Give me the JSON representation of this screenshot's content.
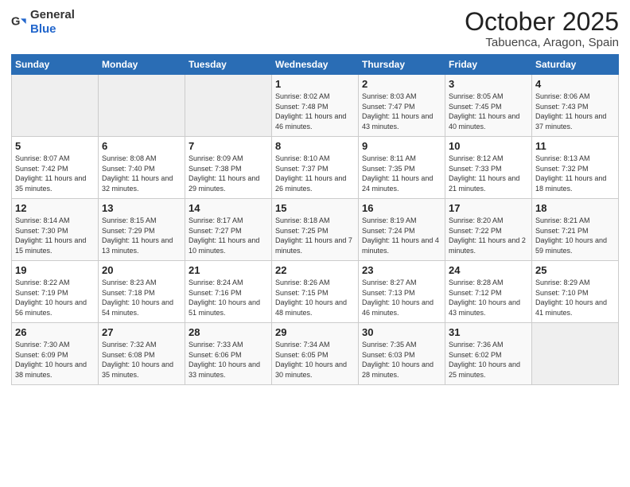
{
  "header": {
    "logo_general": "General",
    "logo_blue": "Blue",
    "title": "October 2025",
    "subtitle": "Tabuenca, Aragon, Spain"
  },
  "columns": [
    "Sunday",
    "Monday",
    "Tuesday",
    "Wednesday",
    "Thursday",
    "Friday",
    "Saturday"
  ],
  "weeks": [
    [
      {
        "day": "",
        "sunrise": "",
        "sunset": "",
        "daylight": ""
      },
      {
        "day": "",
        "sunrise": "",
        "sunset": "",
        "daylight": ""
      },
      {
        "day": "",
        "sunrise": "",
        "sunset": "",
        "daylight": ""
      },
      {
        "day": "1",
        "sunrise": "Sunrise: 8:02 AM",
        "sunset": "Sunset: 7:48 PM",
        "daylight": "Daylight: 11 hours and 46 minutes."
      },
      {
        "day": "2",
        "sunrise": "Sunrise: 8:03 AM",
        "sunset": "Sunset: 7:47 PM",
        "daylight": "Daylight: 11 hours and 43 minutes."
      },
      {
        "day": "3",
        "sunrise": "Sunrise: 8:05 AM",
        "sunset": "Sunset: 7:45 PM",
        "daylight": "Daylight: 11 hours and 40 minutes."
      },
      {
        "day": "4",
        "sunrise": "Sunrise: 8:06 AM",
        "sunset": "Sunset: 7:43 PM",
        "daylight": "Daylight: 11 hours and 37 minutes."
      }
    ],
    [
      {
        "day": "5",
        "sunrise": "Sunrise: 8:07 AM",
        "sunset": "Sunset: 7:42 PM",
        "daylight": "Daylight: 11 hours and 35 minutes."
      },
      {
        "day": "6",
        "sunrise": "Sunrise: 8:08 AM",
        "sunset": "Sunset: 7:40 PM",
        "daylight": "Daylight: 11 hours and 32 minutes."
      },
      {
        "day": "7",
        "sunrise": "Sunrise: 8:09 AM",
        "sunset": "Sunset: 7:38 PM",
        "daylight": "Daylight: 11 hours and 29 minutes."
      },
      {
        "day": "8",
        "sunrise": "Sunrise: 8:10 AM",
        "sunset": "Sunset: 7:37 PM",
        "daylight": "Daylight: 11 hours and 26 minutes."
      },
      {
        "day": "9",
        "sunrise": "Sunrise: 8:11 AM",
        "sunset": "Sunset: 7:35 PM",
        "daylight": "Daylight: 11 hours and 24 minutes."
      },
      {
        "day": "10",
        "sunrise": "Sunrise: 8:12 AM",
        "sunset": "Sunset: 7:33 PM",
        "daylight": "Daylight: 11 hours and 21 minutes."
      },
      {
        "day": "11",
        "sunrise": "Sunrise: 8:13 AM",
        "sunset": "Sunset: 7:32 PM",
        "daylight": "Daylight: 11 hours and 18 minutes."
      }
    ],
    [
      {
        "day": "12",
        "sunrise": "Sunrise: 8:14 AM",
        "sunset": "Sunset: 7:30 PM",
        "daylight": "Daylight: 11 hours and 15 minutes."
      },
      {
        "day": "13",
        "sunrise": "Sunrise: 8:15 AM",
        "sunset": "Sunset: 7:29 PM",
        "daylight": "Daylight: 11 hours and 13 minutes."
      },
      {
        "day": "14",
        "sunrise": "Sunrise: 8:17 AM",
        "sunset": "Sunset: 7:27 PM",
        "daylight": "Daylight: 11 hours and 10 minutes."
      },
      {
        "day": "15",
        "sunrise": "Sunrise: 8:18 AM",
        "sunset": "Sunset: 7:25 PM",
        "daylight": "Daylight: 11 hours and 7 minutes."
      },
      {
        "day": "16",
        "sunrise": "Sunrise: 8:19 AM",
        "sunset": "Sunset: 7:24 PM",
        "daylight": "Daylight: 11 hours and 4 minutes."
      },
      {
        "day": "17",
        "sunrise": "Sunrise: 8:20 AM",
        "sunset": "Sunset: 7:22 PM",
        "daylight": "Daylight: 11 hours and 2 minutes."
      },
      {
        "day": "18",
        "sunrise": "Sunrise: 8:21 AM",
        "sunset": "Sunset: 7:21 PM",
        "daylight": "Daylight: 10 hours and 59 minutes."
      }
    ],
    [
      {
        "day": "19",
        "sunrise": "Sunrise: 8:22 AM",
        "sunset": "Sunset: 7:19 PM",
        "daylight": "Daylight: 10 hours and 56 minutes."
      },
      {
        "day": "20",
        "sunrise": "Sunrise: 8:23 AM",
        "sunset": "Sunset: 7:18 PM",
        "daylight": "Daylight: 10 hours and 54 minutes."
      },
      {
        "day": "21",
        "sunrise": "Sunrise: 8:24 AM",
        "sunset": "Sunset: 7:16 PM",
        "daylight": "Daylight: 10 hours and 51 minutes."
      },
      {
        "day": "22",
        "sunrise": "Sunrise: 8:26 AM",
        "sunset": "Sunset: 7:15 PM",
        "daylight": "Daylight: 10 hours and 48 minutes."
      },
      {
        "day": "23",
        "sunrise": "Sunrise: 8:27 AM",
        "sunset": "Sunset: 7:13 PM",
        "daylight": "Daylight: 10 hours and 46 minutes."
      },
      {
        "day": "24",
        "sunrise": "Sunrise: 8:28 AM",
        "sunset": "Sunset: 7:12 PM",
        "daylight": "Daylight: 10 hours and 43 minutes."
      },
      {
        "day": "25",
        "sunrise": "Sunrise: 8:29 AM",
        "sunset": "Sunset: 7:10 PM",
        "daylight": "Daylight: 10 hours and 41 minutes."
      }
    ],
    [
      {
        "day": "26",
        "sunrise": "Sunrise: 7:30 AM",
        "sunset": "Sunset: 6:09 PM",
        "daylight": "Daylight: 10 hours and 38 minutes."
      },
      {
        "day": "27",
        "sunrise": "Sunrise: 7:32 AM",
        "sunset": "Sunset: 6:08 PM",
        "daylight": "Daylight: 10 hours and 35 minutes."
      },
      {
        "day": "28",
        "sunrise": "Sunrise: 7:33 AM",
        "sunset": "Sunset: 6:06 PM",
        "daylight": "Daylight: 10 hours and 33 minutes."
      },
      {
        "day": "29",
        "sunrise": "Sunrise: 7:34 AM",
        "sunset": "Sunset: 6:05 PM",
        "daylight": "Daylight: 10 hours and 30 minutes."
      },
      {
        "day": "30",
        "sunrise": "Sunrise: 7:35 AM",
        "sunset": "Sunset: 6:03 PM",
        "daylight": "Daylight: 10 hours and 28 minutes."
      },
      {
        "day": "31",
        "sunrise": "Sunrise: 7:36 AM",
        "sunset": "Sunset: 6:02 PM",
        "daylight": "Daylight: 10 hours and 25 minutes."
      },
      {
        "day": "",
        "sunrise": "",
        "sunset": "",
        "daylight": ""
      }
    ]
  ]
}
